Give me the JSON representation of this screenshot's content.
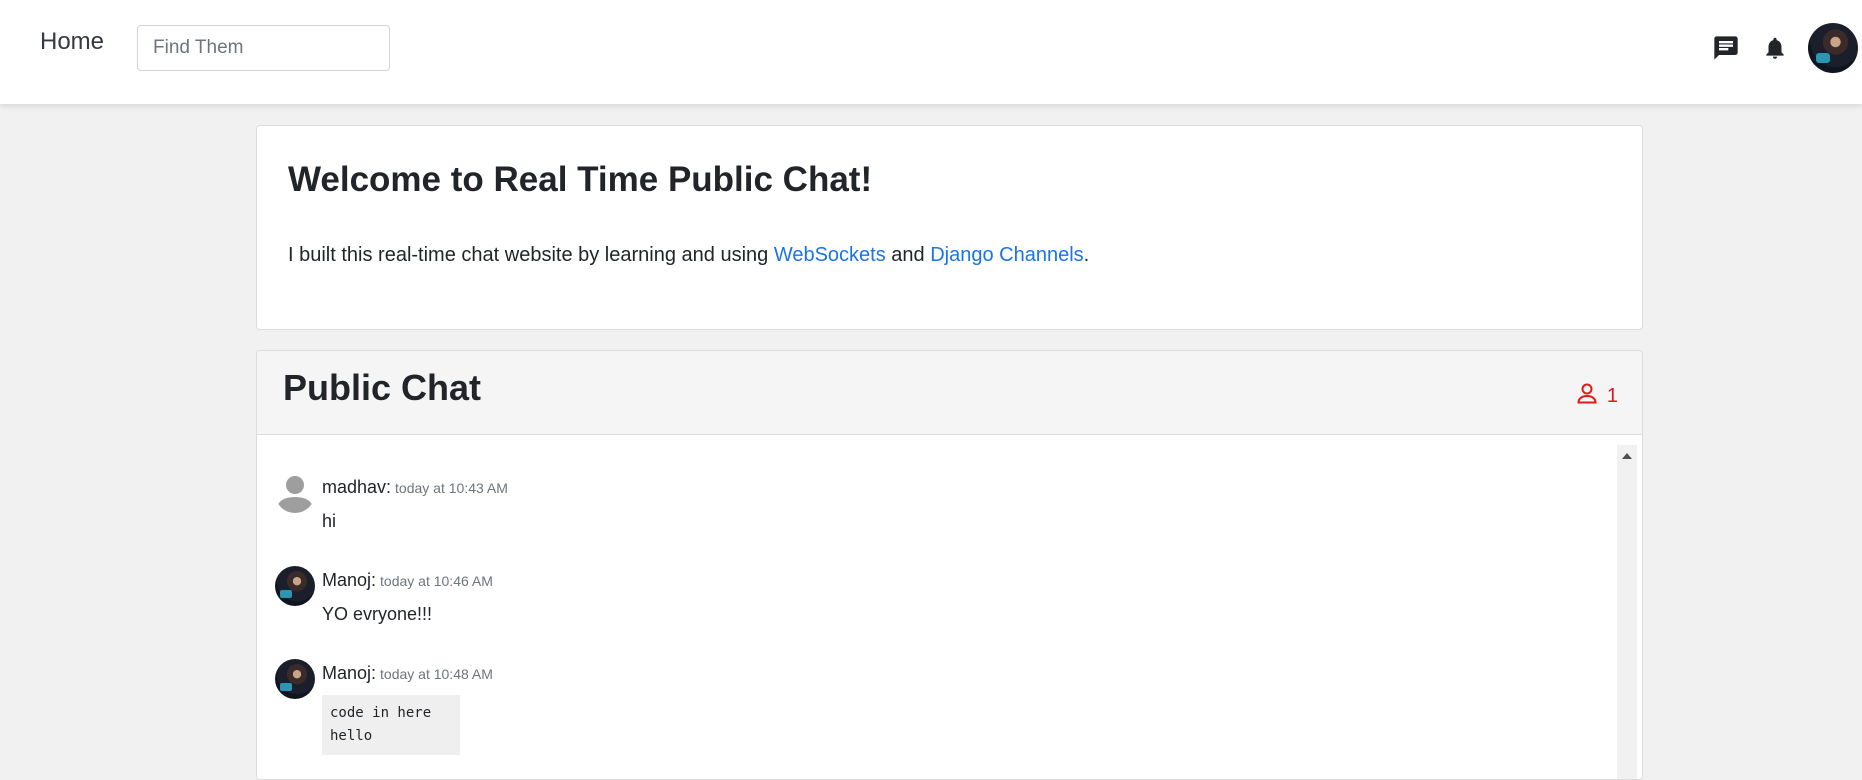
{
  "header": {
    "home_label": "Home",
    "search_placeholder": "Find Them",
    "icons": [
      "chat-icon",
      "bell-icon"
    ]
  },
  "welcome": {
    "title": "Welcome to Real Time Public Chat!",
    "text_before": "I built this real-time chat website by learning and using ",
    "link1": "WebSockets",
    "text_middle": " and ",
    "link2": "Django Channels",
    "text_after": "."
  },
  "chat": {
    "title": "Public Chat",
    "online_count": "1",
    "accent_color": "#e01919",
    "messages": [
      {
        "user": "madhav:",
        "time": "today at 10:43 AM",
        "text": "hi",
        "avatar": "default-avatar-icon"
      },
      {
        "user": "Manoj:",
        "time": "today at 10:46 AM",
        "text": "YO evryone!!!",
        "avatar": "user-photo"
      },
      {
        "user": "Manoj:",
        "time": "today at 10:48 AM",
        "code": "code in here\nhello",
        "avatar": "user-photo"
      }
    ]
  },
  "colors": {
    "link": "#1a73e8",
    "background": "#f1f1f1"
  }
}
